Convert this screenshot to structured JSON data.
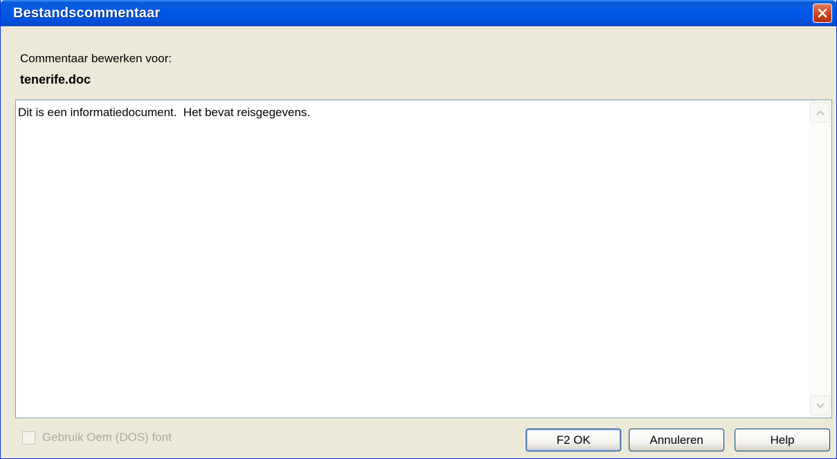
{
  "window": {
    "title": "Bestandscommentaar"
  },
  "labels": {
    "edit_for": "Commentaar bewerken voor:",
    "filename": "tenerife.doc"
  },
  "comment": {
    "text": "Dit is een informatiedocument.  Het bevat reisgegevens."
  },
  "options": {
    "oem_font_label": "Gebruik Oem (DOS) font",
    "oem_font_checked": false,
    "oem_font_enabled": false
  },
  "buttons": {
    "ok_label": "F2 OK",
    "cancel_label": "Annuleren",
    "help_label": "Help"
  },
  "colors": {
    "titlebar": "#0054e3",
    "close_button": "#c8411b",
    "dialog_bg": "#ece9d8"
  }
}
